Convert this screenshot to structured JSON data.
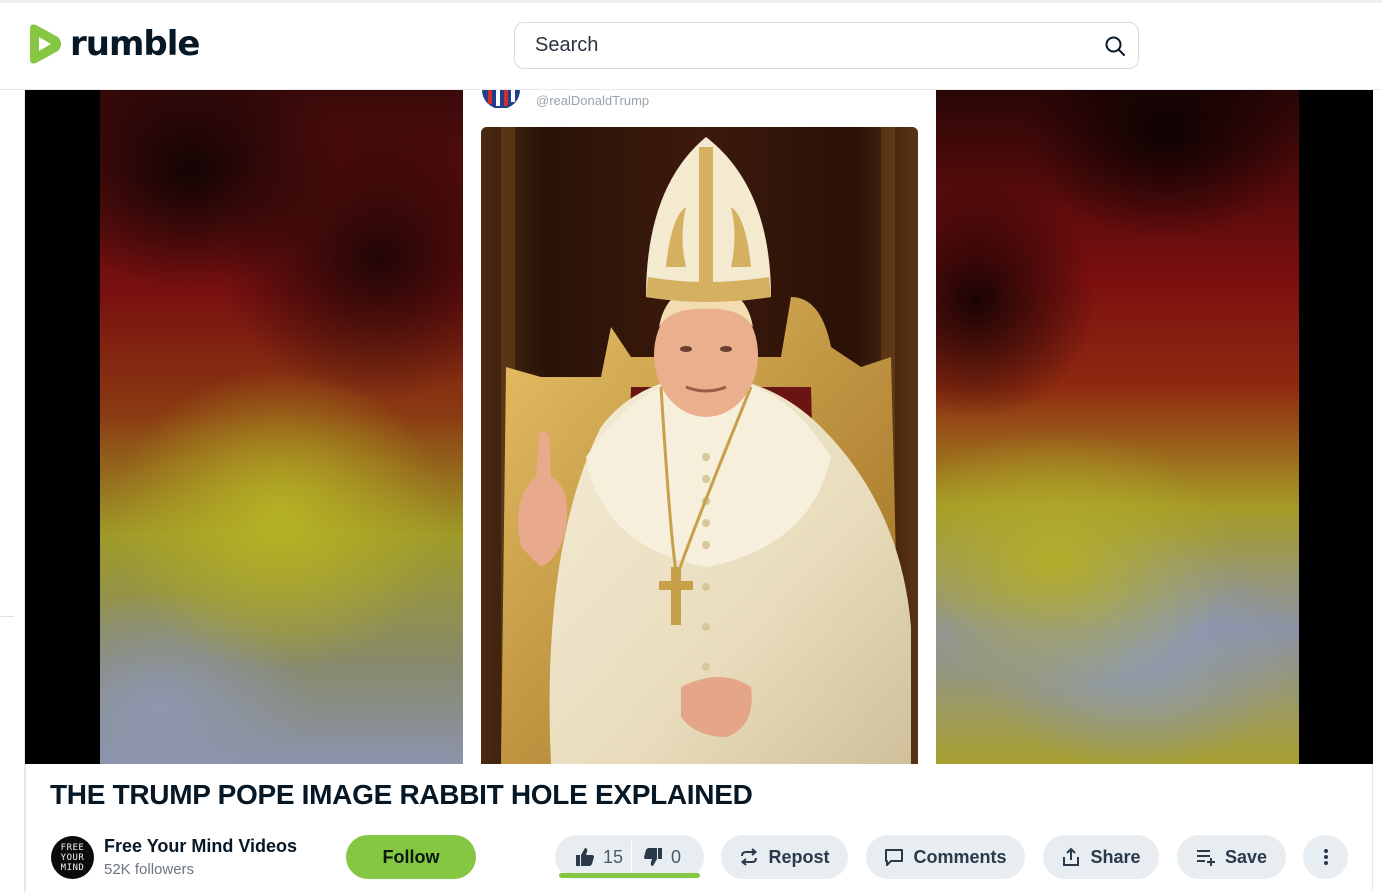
{
  "header": {
    "logo_text": "rumble",
    "search_placeholder": "Search"
  },
  "player": {
    "embedded_handle": "@realDonaldTrump"
  },
  "video": {
    "title": "THE TRUMP POPE IMAGE RABBIT HOLE EXPLAINED"
  },
  "channel": {
    "name": "Free Your Mind Videos",
    "followers": "52K followers",
    "avatar_lines": [
      "FREE",
      "YOUR",
      "MIND"
    ]
  },
  "actions": {
    "follow_label": "Follow",
    "likes": "15",
    "dislikes": "0",
    "like_ratio": 1.0,
    "repost_label": "Repost",
    "comments_label": "Comments",
    "share_label": "Share",
    "save_label": "Save"
  },
  "colors": {
    "brand_green": "#85c742",
    "text_dark": "#061726",
    "pill_bg": "#e8edf1"
  },
  "icons": {
    "logo": "rumble-play-icon",
    "search": "search-icon",
    "like": "thumbs-up-icon",
    "dislike": "thumbs-down-icon",
    "repost": "repost-icon",
    "comments": "comment-icon",
    "share": "share-icon",
    "save": "playlist-add-icon",
    "more": "more-vertical-icon"
  }
}
